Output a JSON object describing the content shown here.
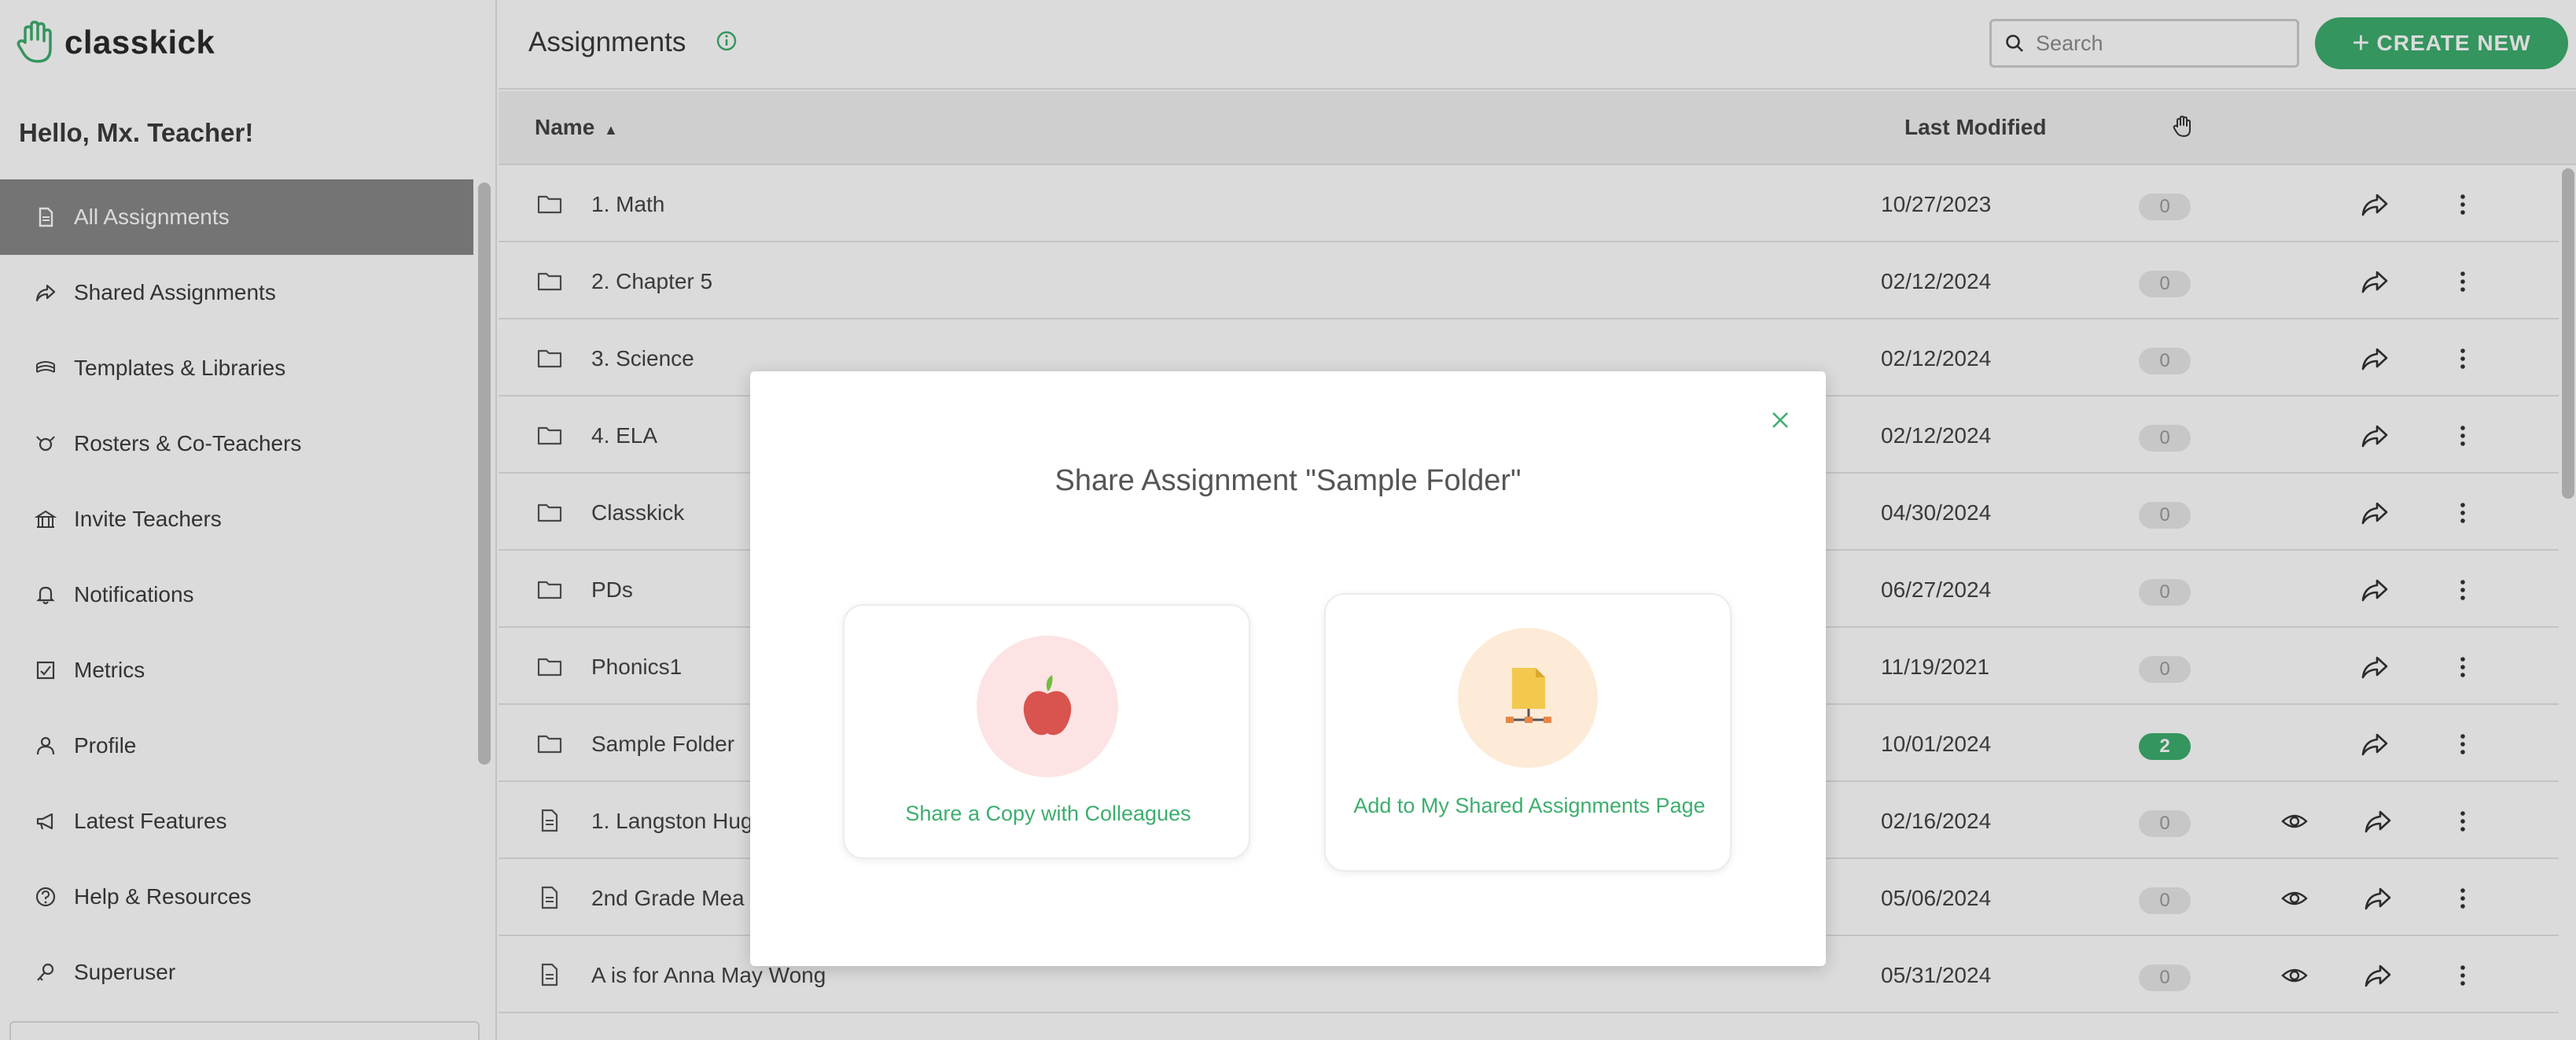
{
  "app": {
    "logo_text": "classkick"
  },
  "sidebar": {
    "greeting": "Hello, Mx. Teacher!",
    "items": [
      {
        "label": "All Assignments",
        "icon": "document-icon",
        "active": true
      },
      {
        "label": "Shared Assignments",
        "icon": "share-icon"
      },
      {
        "label": "Templates & Libraries",
        "icon": "stack-icon"
      },
      {
        "label": "Rosters & Co-Teachers",
        "icon": "rosters-icon"
      },
      {
        "label": "Invite Teachers",
        "icon": "school-icon"
      },
      {
        "label": "Notifications",
        "icon": "bell-icon"
      },
      {
        "label": "Metrics",
        "icon": "metrics-icon"
      },
      {
        "label": "Profile",
        "icon": "person-icon"
      },
      {
        "label": "Latest Features",
        "icon": "megaphone-icon"
      },
      {
        "label": "Help & Resources",
        "icon": "help-icon"
      },
      {
        "label": "Superuser",
        "icon": "key-icon"
      }
    ]
  },
  "header": {
    "title": "Assignments",
    "search_placeholder": "Search",
    "create_label": "CREATE NEW"
  },
  "table": {
    "headers": {
      "name": "Name",
      "modified": "Last Modified"
    },
    "rows": [
      {
        "type": "folder",
        "name": "1. Math",
        "date": "10/27/2023",
        "count": "0"
      },
      {
        "type": "folder",
        "name": "2. Chapter 5",
        "date": "02/12/2024",
        "count": "0"
      },
      {
        "type": "folder",
        "name": "3. Science",
        "date": "02/12/2024",
        "count": "0"
      },
      {
        "type": "folder",
        "name": "4. ELA",
        "date": "02/12/2024",
        "count": "0"
      },
      {
        "type": "folder",
        "name": "Classkick",
        "date": "04/30/2024",
        "count": "0"
      },
      {
        "type": "folder",
        "name": "PDs",
        "date": "06/27/2024",
        "count": "0"
      },
      {
        "type": "folder",
        "name": "Phonics1",
        "date": "11/19/2021",
        "count": "0"
      },
      {
        "type": "folder",
        "name": "Sample Folder",
        "date": "10/01/2024",
        "count": "2",
        "highlight": true
      },
      {
        "type": "doc",
        "name": "1. Langston Hug",
        "date": "02/16/2024",
        "count": "0"
      },
      {
        "type": "doc",
        "name": "2nd Grade Mea",
        "date": "05/06/2024",
        "count": "0"
      },
      {
        "type": "doc",
        "name": "A is for Anna May Wong",
        "date": "05/31/2024",
        "count": "0"
      }
    ]
  },
  "modal": {
    "title": "Share Assignment \"Sample Folder\"",
    "option1": "Share a Copy with Colleagues",
    "option2": "Add to My Shared Assignments Page"
  },
  "colors": {
    "accent": "#3dae6e",
    "active_nav": "#888888"
  }
}
